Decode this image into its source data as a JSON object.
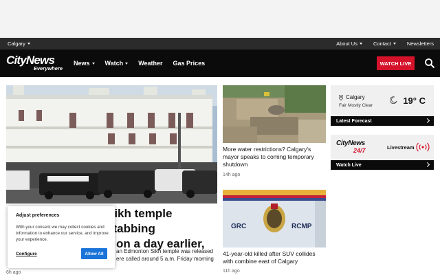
{
  "topbar": {
    "city": "Calgary",
    "links": [
      "About Us",
      "Contact",
      "Newsletters"
    ]
  },
  "navbar": {
    "logo_main": "CityNews",
    "logo_sub": "Everywhere",
    "nav_items": [
      "News",
      "Watch",
      "Weather",
      "Gas Prices"
    ],
    "watch_live_label": "WATCH LIVE"
  },
  "hero": {
    "title": "Suspect in Edmonton Sikh temple stabbing arrested hours later on a day earlier,",
    "title_visible_right_line1": "Sikh temple stabbing",
    "title_visible_right_line2": "on a day earlier,",
    "summary_visible_line1": "an Edmonton Sikh temple was released",
    "summary_visible_line2": "ere called around 5 a.m. Friday morning",
    "time": "6h ago"
  },
  "cards": [
    {
      "title": "More water restrictions? Calgary's mayor speaks to coming temporary shutdown",
      "time": "14h ago"
    },
    {
      "title": "41-year-old killed after SUV collides with combine east of Calgary",
      "time": "11h ago",
      "image_text_left": "GRC",
      "image_text_right": "RCMP"
    }
  ],
  "weather": {
    "location": "Calgary",
    "condition": "Fair Mostly Clear",
    "temperature": "19° C",
    "forecast_link": "Latest Forecast"
  },
  "live": {
    "logo_main": "CityNews",
    "logo_sub": "24/7",
    "label": "Livestream",
    "link": "Watch Live"
  },
  "cookie": {
    "title": "Adjust preferences",
    "body": "With your consent we may collect cookies and information to enhance our service, and improve your experience.",
    "configure": "Configure",
    "allow": "Allow All"
  },
  "colors": {
    "accent": "#d4122a",
    "cookie_button": "#1a73d9",
    "bar": "#0b0b0b"
  }
}
